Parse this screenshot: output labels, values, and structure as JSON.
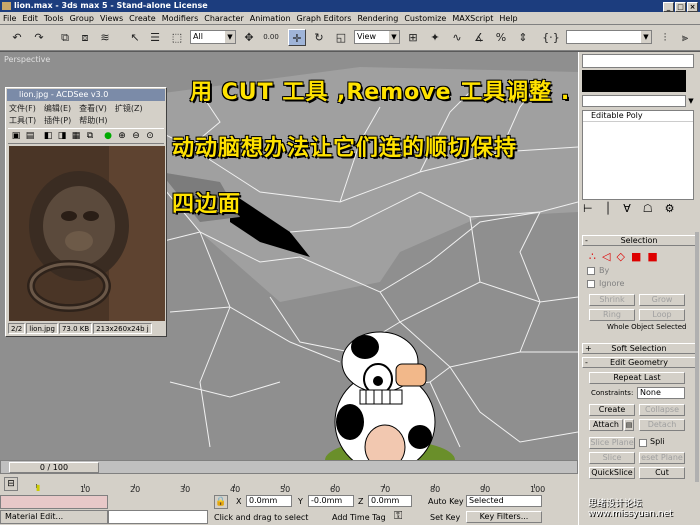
{
  "window": {
    "title": "lion.max - 3ds max 5 - Stand-alone License",
    "buttons": [
      "_",
      "□",
      "×"
    ]
  },
  "menu": [
    "File",
    "Edit",
    "Tools",
    "Group",
    "Views",
    "Create",
    "Modifiers",
    "Character",
    "Animation",
    "Graph Editors",
    "Rendering",
    "Customize",
    "MAXScript",
    "Help"
  ],
  "toolbar": {
    "selection_filter": "All",
    "ref_coord": "View",
    "snap_value": "0.00"
  },
  "viewport": {
    "label": "Perspective",
    "caption_line1": "用 CUT 工具 ,Remove 工具调整 .",
    "caption_line2": "动动脑想办法让它们连的顺切保持",
    "caption_line3": "四边面"
  },
  "acdsee": {
    "title": "lion.jpg - ACDSee v3.0",
    "menu1": [
      "文件(F)",
      "编辑(E)",
      "查看(V)",
      "扩镜(Z)"
    ],
    "menu2": [
      "工具(T)",
      "插件(P)",
      "帮助(H)"
    ],
    "status": [
      "2/2",
      "lion.jpg",
      "73.0 KB",
      "213x260x24b j"
    ]
  },
  "panel": {
    "modifier_list": "Editable Poly",
    "selection_header": "Selection",
    "by_label": "By",
    "ignore_label": "Ignore",
    "shrink": "Shrink",
    "grow": "Grow",
    "ring": "Ring",
    "loop": "Loop",
    "whole_object": "Whole Object Selected",
    "soft_selection": "Soft Selection",
    "edit_geometry": "Edit Geometry",
    "repeat_last": "Repeat Last",
    "constraints_label": "Constraints:",
    "constraints_value": "None",
    "create": "Create",
    "collapse": "Collapse",
    "attach": "Attach",
    "detach": "Detach",
    "slice_plane": "Slice Plane",
    "split": "Spli",
    "slice": "Slice",
    "reset_plane": "eset Plane",
    "quickslice": "QuickSlice",
    "cut": "Cut"
  },
  "timeline": {
    "frame": "0 / 100",
    "ticks": [
      "0",
      "10",
      "20",
      "30",
      "40",
      "50",
      "60",
      "70",
      "80",
      "90",
      "100"
    ]
  },
  "status": {
    "x_label": "X",
    "x_value": "0.0mm",
    "y_label": "Y",
    "y_value": "-0.0mm",
    "z_label": "Z",
    "z_value": "0.0mm",
    "auto_key": "Auto Key",
    "selected": "Selected",
    "set_key": "Set Key",
    "key_filters": "Key Filters...",
    "prompt": "Click and drag to select",
    "add_time_tag": "Add Time Tag",
    "material_editor": "Material Edit..."
  },
  "watermark": "思绪设计论坛 www.missyuan.net"
}
